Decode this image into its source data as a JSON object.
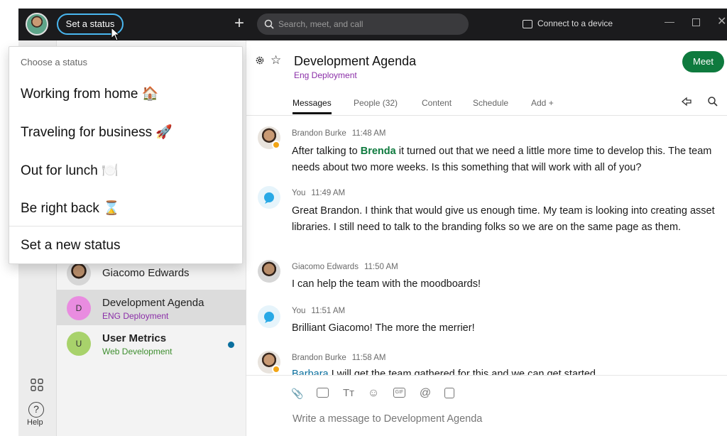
{
  "topbar": {
    "status_button": "Set a status",
    "search_placeholder": "Search, meet, and call",
    "connect_label": "Connect to a device"
  },
  "status_menu": {
    "heading": "Choose a status",
    "items": [
      {
        "label": "Working from home 🏠"
      },
      {
        "label": "Traveling for business 🚀"
      },
      {
        "label": "Out for lunch 🍽️"
      },
      {
        "label": "Be right back ⌛"
      }
    ],
    "new_status": "Set a new status"
  },
  "rail": {
    "help_label": "Help"
  },
  "spaces": [
    {
      "name": "Giacomo Edwards",
      "subtitle": "",
      "avatar_letter": ""
    },
    {
      "name": "Development Agenda",
      "subtitle": "ENG Deployment",
      "avatar_letter": "D",
      "avatar_color": "#e98ce0",
      "subtitle_color": "#8b2fa8"
    },
    {
      "name": "User Metrics",
      "subtitle": "Web Development",
      "avatar_letter": "U",
      "avatar_color": "#a8d26b",
      "subtitle_color": "#3e8e2f"
    }
  ],
  "space_header": {
    "title": "Development Agenda",
    "team": "Eng Deployment",
    "meet_button": "Meet",
    "tabs": [
      "Messages",
      "People (32)",
      "Content",
      "Schedule",
      "Add"
    ]
  },
  "messages": [
    {
      "sender": "Brandon Burke",
      "time": "11:48 AM",
      "pre": "After talking to ",
      "mention": "Brenda",
      "post": " it turned out that we need a little more time to develop this. The team needs about two more weeks. Is this something that will work with all of you?"
    },
    {
      "sender": "You",
      "time": "11:49 AM",
      "text": "Great Brandon. I think that would give us enough time. My team is looking into creating asset libraries. I still need to talk to the branding folks so we are on the same page as them."
    },
    {
      "sender": "Giacomo Edwards",
      "time": "11:50 AM",
      "text": "I can help the team with the moodboards!"
    },
    {
      "sender": "You",
      "time": "11:51 AM",
      "text": "Brilliant Giacomo! The more the merrier!"
    },
    {
      "sender": "Brandon Burke",
      "time": "11:58 AM",
      "mention": "Barbara",
      "post": " I will get the team gathered for this and we can get started"
    }
  ],
  "composer": {
    "placeholder": "Write a message to Development Agenda"
  },
  "colors": {
    "accent_green": "#0e7a3e",
    "status_ring": "#49b6ef",
    "topbar": "#1b1b1d"
  }
}
